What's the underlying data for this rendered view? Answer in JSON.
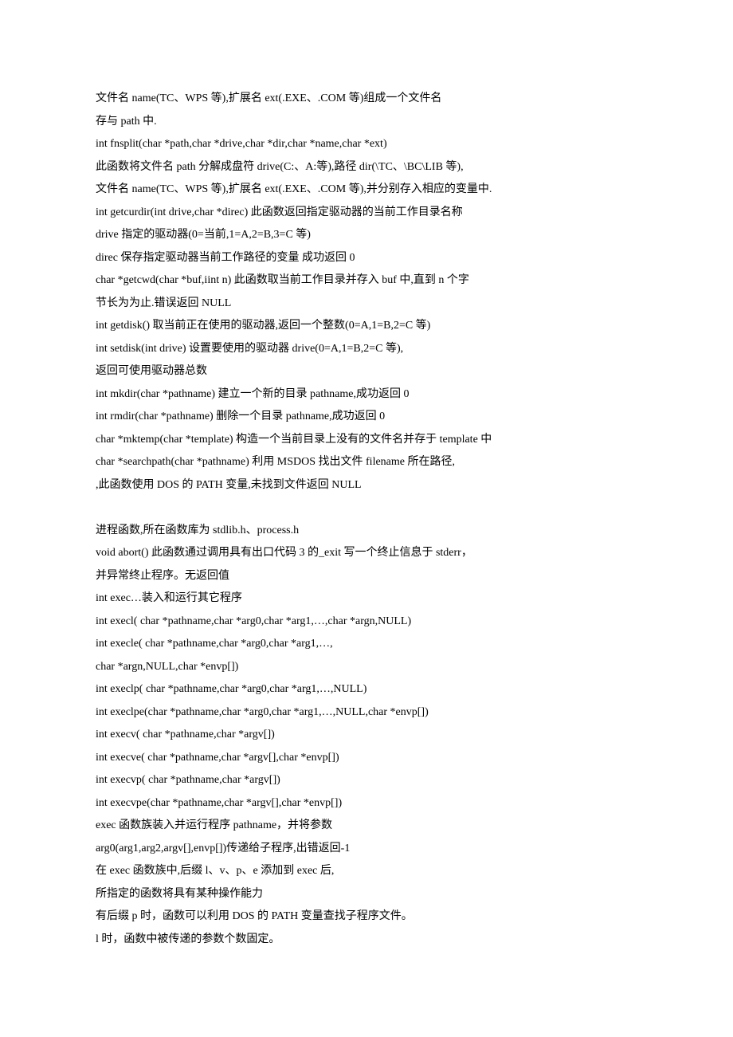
{
  "lines": [
    "文件名 name(TC、WPS 等),扩展名 ext(.EXE、.COM 等)组成一个文件名",
    "存与 path 中.",
    "int fnsplit(char *path,char *drive,char *dir,char *name,char *ext)",
    "此函数将文件名 path 分解成盘符 drive(C:、A:等),路径 dir(\\TC、\\BC\\LIB 等),",
    "文件名 name(TC、WPS 等),扩展名 ext(.EXE、.COM 等),并分别存入相应的变量中.",
    "int getcurdir(int drive,char *direc) 此函数返回指定驱动器的当前工作目录名称",
    "drive 指定的驱动器(0=当前,1=A,2=B,3=C 等)",
    "direc 保存指定驱动器当前工作路径的变量 成功返回 0",
    "char *getcwd(char *buf,iint n) 此函数取当前工作目录并存入 buf 中,直到 n 个字",
    "节长为为止.错误返回 NULL",
    "int getdisk() 取当前正在使用的驱动器,返回一个整数(0=A,1=B,2=C 等)",
    "int setdisk(int drive) 设置要使用的驱动器 drive(0=A,1=B,2=C 等),",
    "返回可使用驱动器总数",
    "int mkdir(char *pathname) 建立一个新的目录 pathname,成功返回 0",
    "int rmdir(char *pathname) 删除一个目录 pathname,成功返回 0",
    "char *mktemp(char *template) 构造一个当前目录上没有的文件名并存于 template 中",
    "char *searchpath(char *pathname) 利用 MSDOS 找出文件 filename 所在路径,",
    ",此函数使用 DOS 的 PATH 变量,未找到文件返回 NULL",
    "",
    "进程函数,所在函数库为 stdlib.h、process.h",
    "void abort() 此函数通过调用具有出口代码 3 的_exit 写一个终止信息于 stderr，",
    "并异常终止程序。无返回值",
    "int exec…装入和运行其它程序",
    "int execl( char *pathname,char *arg0,char *arg1,…,char *argn,NULL)",
    "int execle( char *pathname,char *arg0,char *arg1,…,",
    "char *argn,NULL,char *envp[])",
    "int execlp( char *pathname,char *arg0,char *arg1,…,NULL)",
    "int execlpe(char *pathname,char *arg0,char *arg1,…,NULL,char *envp[])",
    "int execv( char *pathname,char *argv[])",
    "int execve( char *pathname,char *argv[],char *envp[])",
    "int execvp( char *pathname,char *argv[])",
    "int execvpe(char *pathname,char *argv[],char *envp[])",
    "exec 函数族装入并运行程序 pathname，并将参数",
    "arg0(arg1,arg2,argv[],envp[])传递给子程序,出错返回-1",
    "在 exec 函数族中,后缀 l、v、p、e 添加到 exec 后,",
    "所指定的函数将具有某种操作能力",
    "有后缀 p 时，函数可以利用 DOS 的 PATH 变量查找子程序文件。",
    "l 时，函数中被传递的参数个数固定。"
  ]
}
